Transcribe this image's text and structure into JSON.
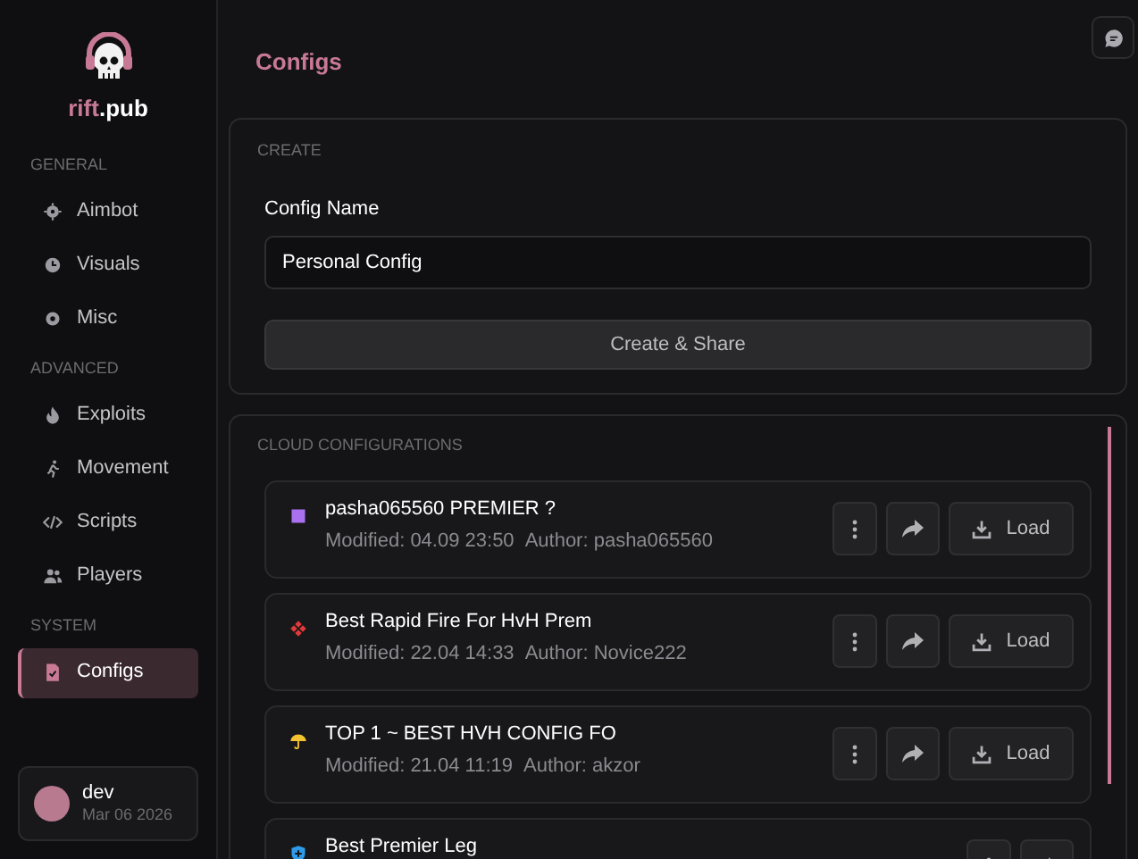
{
  "sidebar": {
    "brand": {
      "accent": "rift",
      "rest": ".pub"
    },
    "sections": [
      {
        "title": "GENERAL",
        "items": [
          {
            "label": "Aimbot",
            "selected": false
          },
          {
            "label": "Visuals",
            "selected": false
          },
          {
            "label": "Misc",
            "selected": false
          }
        ]
      },
      {
        "title": "ADVANCED",
        "items": [
          {
            "label": "Exploits",
            "selected": false
          },
          {
            "label": "Movement",
            "selected": false
          },
          {
            "label": "Scripts",
            "selected": false
          },
          {
            "label": "Players",
            "selected": false
          }
        ]
      },
      {
        "title": "SYSTEM",
        "items": [
          {
            "label": "Configs",
            "selected": true
          }
        ]
      }
    ],
    "user": {
      "name": "dev",
      "date": "Mar 06 2026"
    }
  },
  "page": {
    "title": "Configs",
    "create": {
      "heading": "CREATE",
      "label": "Config Name",
      "value": "Personal Config",
      "button": "Create & Share"
    },
    "cloud": {
      "heading": "CLOUD CONFIGURATIONS",
      "configs": [
        {
          "kind": "square",
          "color": "#a970f0",
          "name": "pasha065560 PREMIER ?",
          "modified": "Modified: 04.09 23:50",
          "author": "Author: pasha065560",
          "button": "Load"
        },
        {
          "kind": "diamonds",
          "color": "#e03a3a",
          "name": "Best Rapid Fire For HvH Prem",
          "modified": "Modified: 22.04 14:33",
          "author": "Author: Novice222",
          "button": "Load"
        },
        {
          "kind": "umbrella",
          "color": "#f2c230",
          "name": "TOP 1 ~ BEST HVH CONFIG FO",
          "modified": "Modified: 21.04 11:19",
          "author": "Author: akzor",
          "button": "Load"
        },
        {
          "kind": "shield",
          "color": "#2f9be8",
          "name": "Best Premier Leg"
        }
      ]
    }
  }
}
